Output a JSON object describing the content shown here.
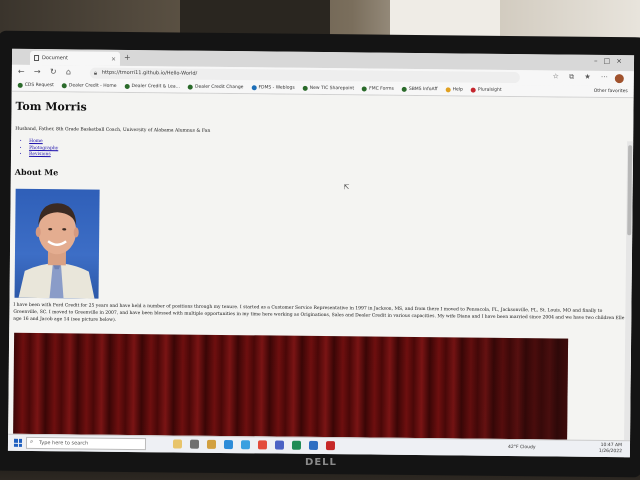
{
  "browser": {
    "tab_title": "Document",
    "url": "https://tmorri11.github.io/Hello-World/",
    "bookmarks": [
      {
        "label": "CDS Request",
        "color": "green"
      },
      {
        "label": "Dealer Credit - Home",
        "color": "green"
      },
      {
        "label": "Dealer Credit & Lea...",
        "color": "green"
      },
      {
        "label": "Dealer Credit Change",
        "color": "green"
      },
      {
        "label": "FDMS - Weblogs",
        "color": "blue"
      },
      {
        "label": "New TIC Sharepoint",
        "color": "green"
      },
      {
        "label": "FMC Forms",
        "color": "green"
      },
      {
        "label": "SBMS InfoAff",
        "color": "green"
      },
      {
        "label": "Help",
        "color": "orange"
      },
      {
        "label": "Pluralsight",
        "color": "red"
      }
    ],
    "other_favorites": "Other favorites"
  },
  "page": {
    "title": "Tom Morris",
    "tagline": "Husband, Father, 8th Grade Basketball Coach, University of Alabama Alumnus & Fan",
    "nav_links": [
      "Home",
      "Photography",
      "Revisions"
    ],
    "section_heading": "About Me",
    "bio": "I have been with Ford Credit for 25 years and have held a number of positions through my tenure. I started as a Customer Service Representative in 1997 in Jackson, MS, and from there I moved to Pensacola, FL, Jacksonville, FL, St. Louis, MO and finally to Greenville, SC. I moved to Greenville in 2007, and have been blessed with multiple opportunities in my time here working as Originations, Sales and Dealer Credit in various capacities. My wife Diana and I have been married since 2004 and we have two children Elle age 16 and Jacob age 14 (see picture below)."
  },
  "taskbar": {
    "search_placeholder": "Type here to search",
    "weather": "42°F Cloudy",
    "time": "10:47 AM",
    "date": "1/26/2022"
  },
  "monitor_brand": "DELL"
}
